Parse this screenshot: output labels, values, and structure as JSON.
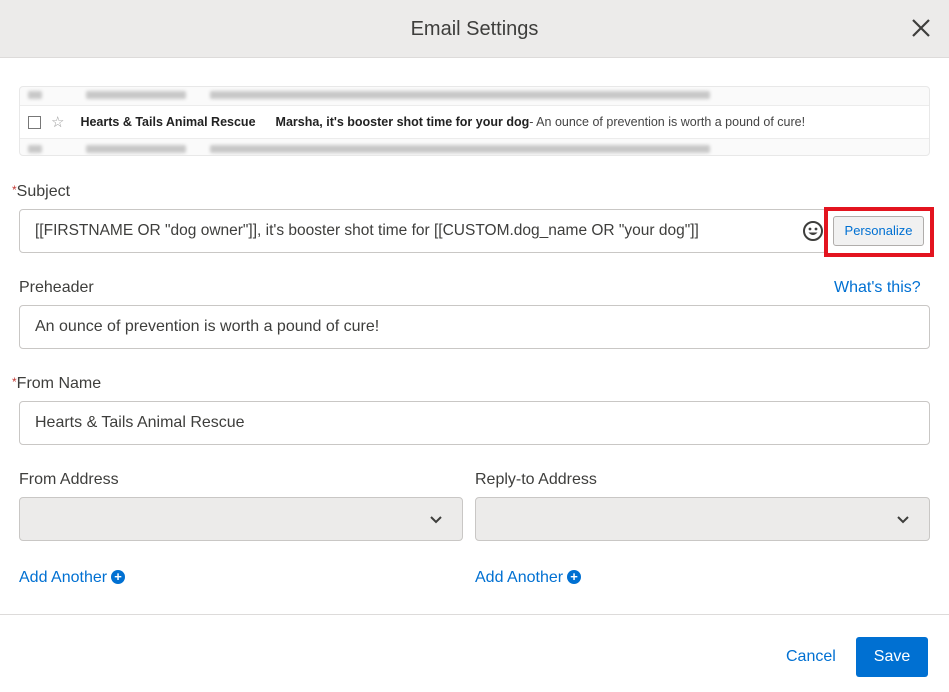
{
  "header": {
    "title": "Email Settings",
    "close_icon": "close-icon"
  },
  "preview": {
    "sender": "Hearts & Tails Animal Rescue",
    "subject": "Marsha, it's booster shot time for your dog",
    "snippet": "- An ounce of prevention is worth a pound of cure!"
  },
  "subject": {
    "label": "Subject",
    "required": "*",
    "value": "[[FIRSTNAME OR \"dog owner\"]], it's booster shot time for [[CUSTOM.dog_name OR \"your dog\"]]",
    "emoji_icon": "smiley-icon",
    "personalize": "Personalize"
  },
  "preheader": {
    "label": "Preheader",
    "help_link": "What's this?",
    "value": "An ounce of prevention is worth a pound of cure!"
  },
  "from_name": {
    "label": "From Name",
    "required": "*",
    "value": "Hearts & Tails Animal Rescue"
  },
  "from_address": {
    "label": "From Address",
    "value": "",
    "add_another": "Add Another"
  },
  "reply_to": {
    "label": "Reply-to Address",
    "value": "",
    "add_another": "Add Another"
  },
  "footer": {
    "cancel": "Cancel",
    "save": "Save"
  },
  "colors": {
    "accent": "#0070d2",
    "highlight": "#e3141f",
    "required": "#c23934"
  }
}
